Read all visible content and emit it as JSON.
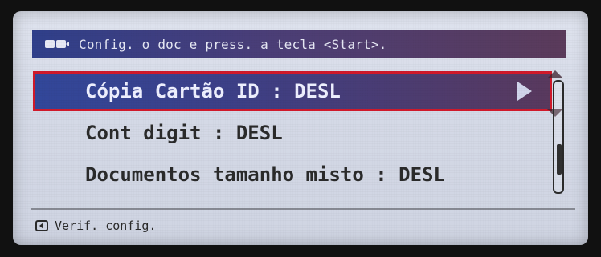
{
  "header": {
    "icon": "copy-icon",
    "text": "Config. o doc e press. a tecla <Start>."
  },
  "menu": {
    "items": [
      {
        "label": "Cópia Cartão ID : DESL",
        "selected": true
      },
      {
        "label": "Cont digit : DESL",
        "selected": false
      },
      {
        "label": "Documentos tamanho misto : DESL",
        "selected": false
      }
    ]
  },
  "status": {
    "icon": "back-icon",
    "text": "Verif. config."
  },
  "colors": {
    "highlight_outline": "#d0192a"
  }
}
